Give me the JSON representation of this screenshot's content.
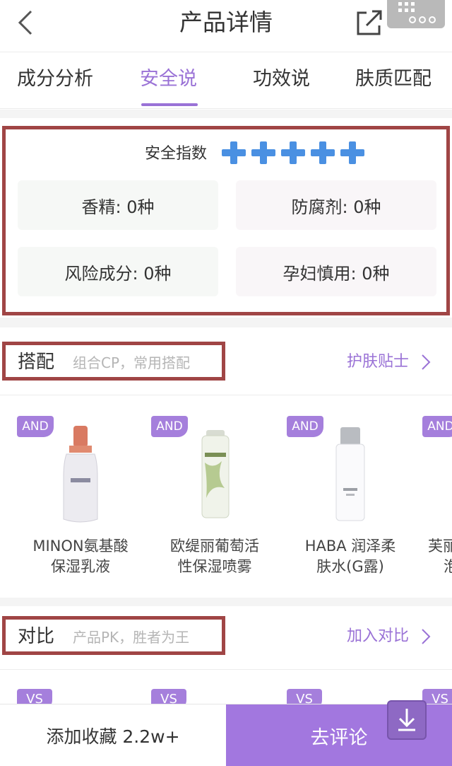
{
  "header": {
    "title": "产品详情",
    "icons": {
      "back": "chevron-left-icon",
      "share": "share-icon",
      "more": "more-icon"
    }
  },
  "tabs": [
    {
      "label": "成分分析",
      "active": false
    },
    {
      "label": "安全说",
      "active": true
    },
    {
      "label": "功效说",
      "active": false
    },
    {
      "label": "肤质匹配",
      "active": false
    }
  ],
  "safety": {
    "title": "安全指数",
    "rating": 5,
    "rating_max": 5,
    "stats": [
      {
        "label": "香精: 0种"
      },
      {
        "label": "防腐剂: 0种"
      },
      {
        "label": "风险成分: 0种"
      },
      {
        "label": "孕妇慎用: 0种"
      }
    ]
  },
  "pairing": {
    "title": "搭配",
    "subtitle": "组合CP，常用搭配",
    "link": "护肤贴士",
    "badge": "AND",
    "products": [
      {
        "name_line1": "MINON氨基酸",
        "name_line2": "保湿乳液"
      },
      {
        "name_line1": "欧缇丽葡萄活",
        "name_line2": "性保湿喷雾"
      },
      {
        "name_line1": "HABA 润泽柔",
        "name_line2": "肤水(G露)"
      },
      {
        "name_line1": "芙丽",
        "name_line2": "泡"
      }
    ]
  },
  "compare": {
    "title": "对比",
    "subtitle": "产品PK，胜者为王",
    "link": "加入对比",
    "badge": "VS"
  },
  "bottom": {
    "favorite": "添加收藏 2.2w+",
    "review": "去评论"
  },
  "colors": {
    "accent": "#9a72d6",
    "highlight_border": "#a04545",
    "rating_cross": "#4a90e2"
  }
}
